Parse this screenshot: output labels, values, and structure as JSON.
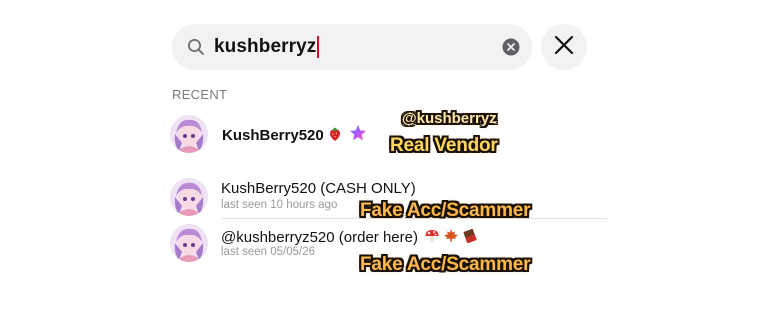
{
  "search": {
    "query": "kushberryz"
  },
  "section": {
    "title": "RECENT"
  },
  "results": [
    {
      "name": "KushBerry520",
      "subtitle": ""
    },
    {
      "name": "KushBerry520 (CASH ONLY)",
      "subtitle": "last seen 10 hours ago"
    },
    {
      "name": "@kushberryz520 (order here)",
      "subtitle": "last seen 05/05/26"
    }
  ],
  "annotations": {
    "handle": "@kushberryz",
    "real_label": "Real Vendor",
    "fake_label_1": "Fake Acc/Scammer",
    "fake_label_2": "Fake Acc/Scammer"
  },
  "icons": {
    "search": "search-icon",
    "clear": "clear-icon",
    "close": "close-icon",
    "verified": "star-icon",
    "strawberry": "strawberry-emoji",
    "mushroom": "mushroom-emoji",
    "leaf": "maple-leaf-emoji",
    "chocolate": "chocolate-bar-emoji"
  },
  "colors": {
    "field_bg": "#f2f2f3",
    "caret": "#c8102e",
    "muted_text": "#9a9aa0",
    "badge_fill": "#ffd75e",
    "badge_outline": "#1a1208"
  }
}
